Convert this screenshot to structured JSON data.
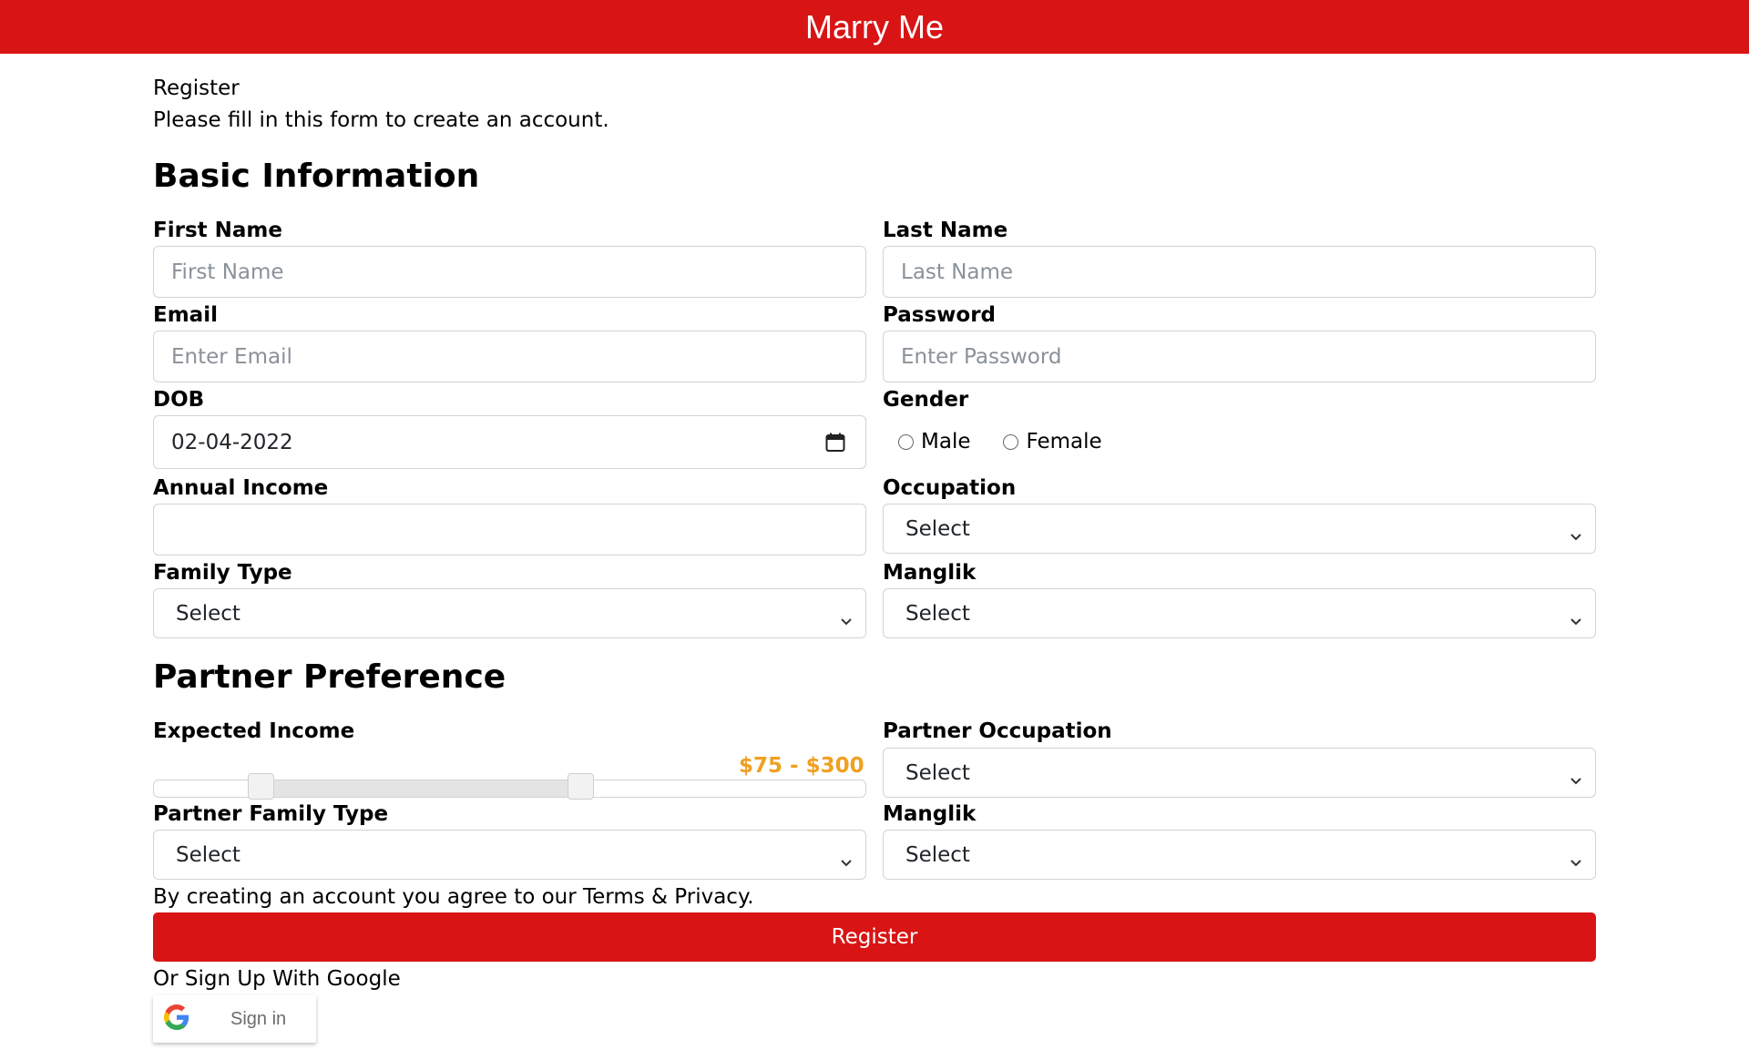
{
  "header": {
    "title": "Marry Me"
  },
  "intro": {
    "title": "Register",
    "subtitle": "Please fill in this form to create an account."
  },
  "basic": {
    "heading": "Basic Information",
    "first_name": {
      "label": "First Name",
      "placeholder": "First Name",
      "value": ""
    },
    "last_name": {
      "label": "Last Name",
      "placeholder": "Last Name",
      "value": ""
    },
    "email": {
      "label": "Email",
      "placeholder": "Enter Email",
      "value": ""
    },
    "password": {
      "label": "Password",
      "placeholder": "Enter Password",
      "value": ""
    },
    "dob": {
      "label": "DOB",
      "value": "02-04-2022",
      "icon": "calendar-icon"
    },
    "gender": {
      "label": "Gender",
      "options": [
        "Male",
        "Female"
      ],
      "selected": null
    },
    "annual_income": {
      "label": "Annual Income",
      "value": ""
    },
    "occupation": {
      "label": "Occupation",
      "value": "Select"
    },
    "family_type": {
      "label": "Family Type",
      "value": "Select"
    },
    "manglik": {
      "label": "Manglik",
      "value": "Select"
    }
  },
  "partner": {
    "heading": "Partner Preference",
    "expected_income": {
      "label": "Expected Income",
      "range_text": "$75 - $300",
      "min": 75,
      "max": 300
    },
    "occupation": {
      "label": "Partner Occupation",
      "value": "Select"
    },
    "family_type": {
      "label": "Partner Family Type",
      "value": "Select"
    },
    "manglik": {
      "label": "Manglik",
      "value": "Select"
    }
  },
  "footer": {
    "terms": "By creating an account you agree to our Terms & Privacy.",
    "register_label": "Register",
    "google_prompt": "Or Sign Up With Google",
    "google_signin_label": "Sign in"
  },
  "colors": {
    "brand": "#d81414",
    "range_text": "#f0a020"
  }
}
